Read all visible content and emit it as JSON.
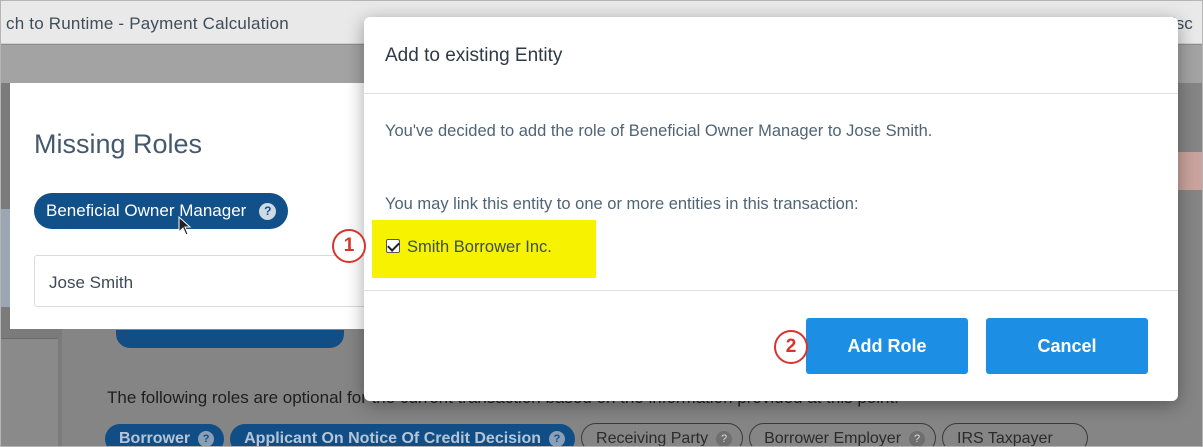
{
  "background": {
    "title": "ch to Runtime - Payment Calculation",
    "title_right": "isc",
    "optional_text": "The following roles are optional for the current transaction based on the information provided at this point:",
    "pills": [
      {
        "label": "Borrower",
        "style": "filled"
      },
      {
        "label": "Applicant On Notice Of Credit Decision",
        "style": "filled"
      },
      {
        "label": "Receiving Party",
        "style": "outlined"
      },
      {
        "label": "Borrower Employer",
        "style": "outlined"
      },
      {
        "label": "IRS Taxpayer",
        "style": "outlined"
      }
    ]
  },
  "roles_panel": {
    "title": "Missing Roles",
    "role_pill": "Beneficial Owner Manager",
    "help_icon": "?",
    "entity_name": "Jose Smith"
  },
  "modal": {
    "title": "Add to existing Entity",
    "message": "You've decided to add the role of Beneficial Owner Manager to Jose Smith.",
    "link_prompt": "You may link this entity to one or more entities in this transaction:",
    "entities": [
      {
        "label": "Smith Borrower Inc.",
        "checked": true
      }
    ],
    "add_button": "Add Role",
    "cancel_button": "Cancel"
  },
  "annotations": {
    "marker_1": "1",
    "marker_2": "2"
  },
  "colors": {
    "primary_button": "#1c8fe4",
    "pill_blue": "#12508a",
    "highlight": "#f6f200",
    "marker_red": "#d8342e"
  }
}
